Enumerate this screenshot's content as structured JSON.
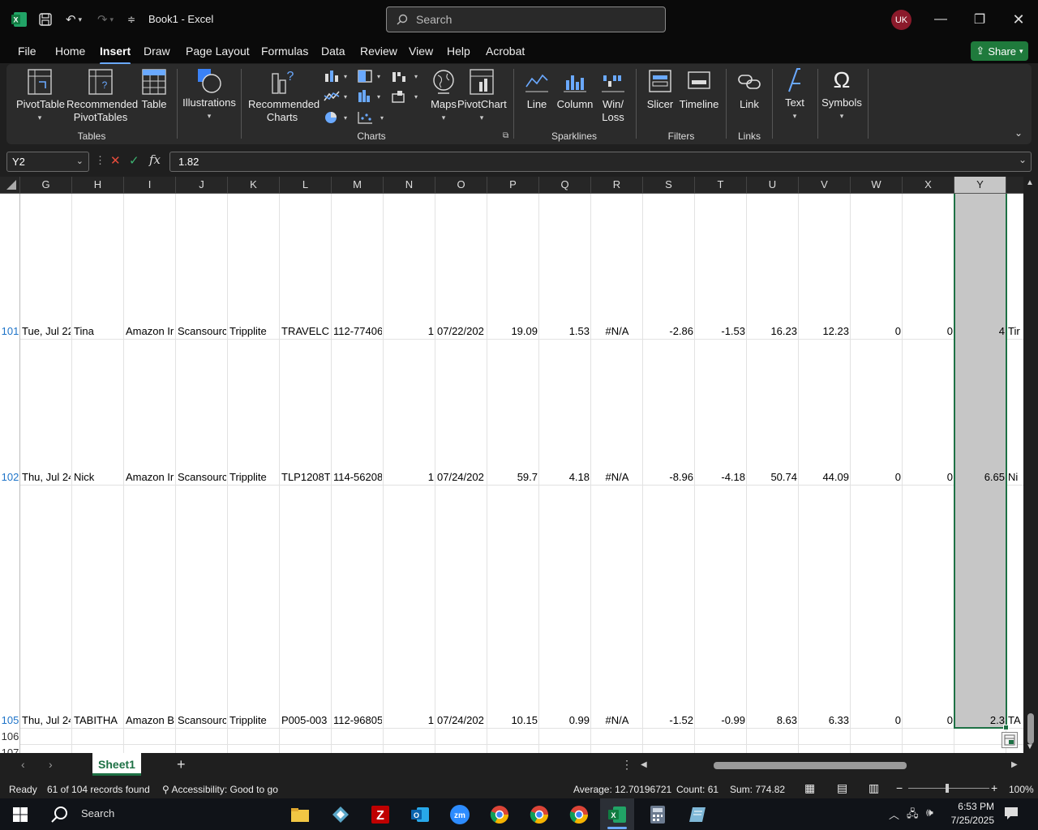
{
  "app": {
    "title": "Book1  -  Excel",
    "search_placeholder": "Search",
    "user_initials": "UK",
    "share_label": "Share"
  },
  "menu_tabs": [
    "File",
    "Home",
    "Insert",
    "Draw",
    "Page Layout",
    "Formulas",
    "Data",
    "Review",
    "View",
    "Help",
    "Acrobat"
  ],
  "active_tab": "Insert",
  "ribbon": {
    "pivottable": "PivotTable",
    "recommended_pivottables": [
      "Recommended",
      "PivotTables"
    ],
    "table": "Table",
    "group_tables": "Tables",
    "illustrations": "Illustrations",
    "recommended_charts": [
      "Recommended",
      "Charts"
    ],
    "maps": "Maps",
    "pivotchart": "PivotChart",
    "group_charts": "Charts",
    "line": "Line",
    "column": "Column",
    "winloss": [
      "Win/",
      "Loss"
    ],
    "group_sparklines": "Sparklines",
    "slicer": "Slicer",
    "timeline": "Timeline",
    "group_filters": "Filters",
    "link": "Link",
    "group_links": "Links",
    "text": "Text",
    "symbols": "Symbols"
  },
  "formula_bar": {
    "name_box": "Y2",
    "formula": "1.82"
  },
  "columns": [
    "G",
    "H",
    "I",
    "J",
    "K",
    "L",
    "M",
    "N",
    "O",
    "P",
    "Q",
    "R",
    "S",
    "T",
    "U",
    "V",
    "W",
    "X",
    "Y"
  ],
  "selected_column": "Y",
  "rows": [
    {
      "num": "101",
      "G": "Tue, Jul 22",
      "H": "Tina",
      "I": "Amazon Ir",
      "J": "Scansourc",
      "K": "Tripplite",
      "L": "TRAVELCU",
      "M": "112-77406",
      "N": "1",
      "O": "07/22/202",
      "P": "19.09",
      "Q": "1.53",
      "R": "#N/A",
      "S": "-2.86",
      "T": "-1.53",
      "U": "16.23",
      "V": "12.23",
      "W": "0",
      "X": "0",
      "Y": "4",
      "Z": "Tir"
    },
    {
      "num": "102",
      "G": "Thu, Jul 24",
      "H": "Nick",
      "I": "Amazon Ir",
      "J": "Scansourc",
      "K": "Tripplite",
      "L": "TLP1208TE",
      "M": "114-56208",
      "N": "1",
      "O": "07/24/202",
      "P": "59.7",
      "Q": "4.18",
      "R": "#N/A",
      "S": "-8.96",
      "T": "-4.18",
      "U": "50.74",
      "V": "44.09",
      "W": "0",
      "X": "0",
      "Y": "6.65",
      "Z": "Ni"
    },
    {
      "num": "105",
      "G": "Thu, Jul 24",
      "H": "TABITHA",
      "I": "Amazon B",
      "J": "Scansourc",
      "K": "Tripplite",
      "L": "P005-003",
      "M": "112-96805",
      "N": "1",
      "O": "07/24/202",
      "P": "10.15",
      "Q": "0.99",
      "R": "#N/A",
      "S": "-1.52",
      "T": "-0.99",
      "U": "8.63",
      "V": "6.33",
      "W": "0",
      "X": "0",
      "Y": "2.3",
      "Z": "TA"
    }
  ],
  "extra_rows": [
    "106",
    "107"
  ],
  "sheet": {
    "name": "Sheet1"
  },
  "status": {
    "ready": "Ready",
    "records": "61 of 104 records found",
    "accessibility": "Accessibility: Good to go",
    "average": "Average: 12.70196721",
    "count": "Count: 61",
    "sum": "Sum: 774.82",
    "zoom": "100%"
  },
  "taskbar": {
    "search": "Search",
    "time": "6:53 PM",
    "date": "7/25/2025"
  }
}
